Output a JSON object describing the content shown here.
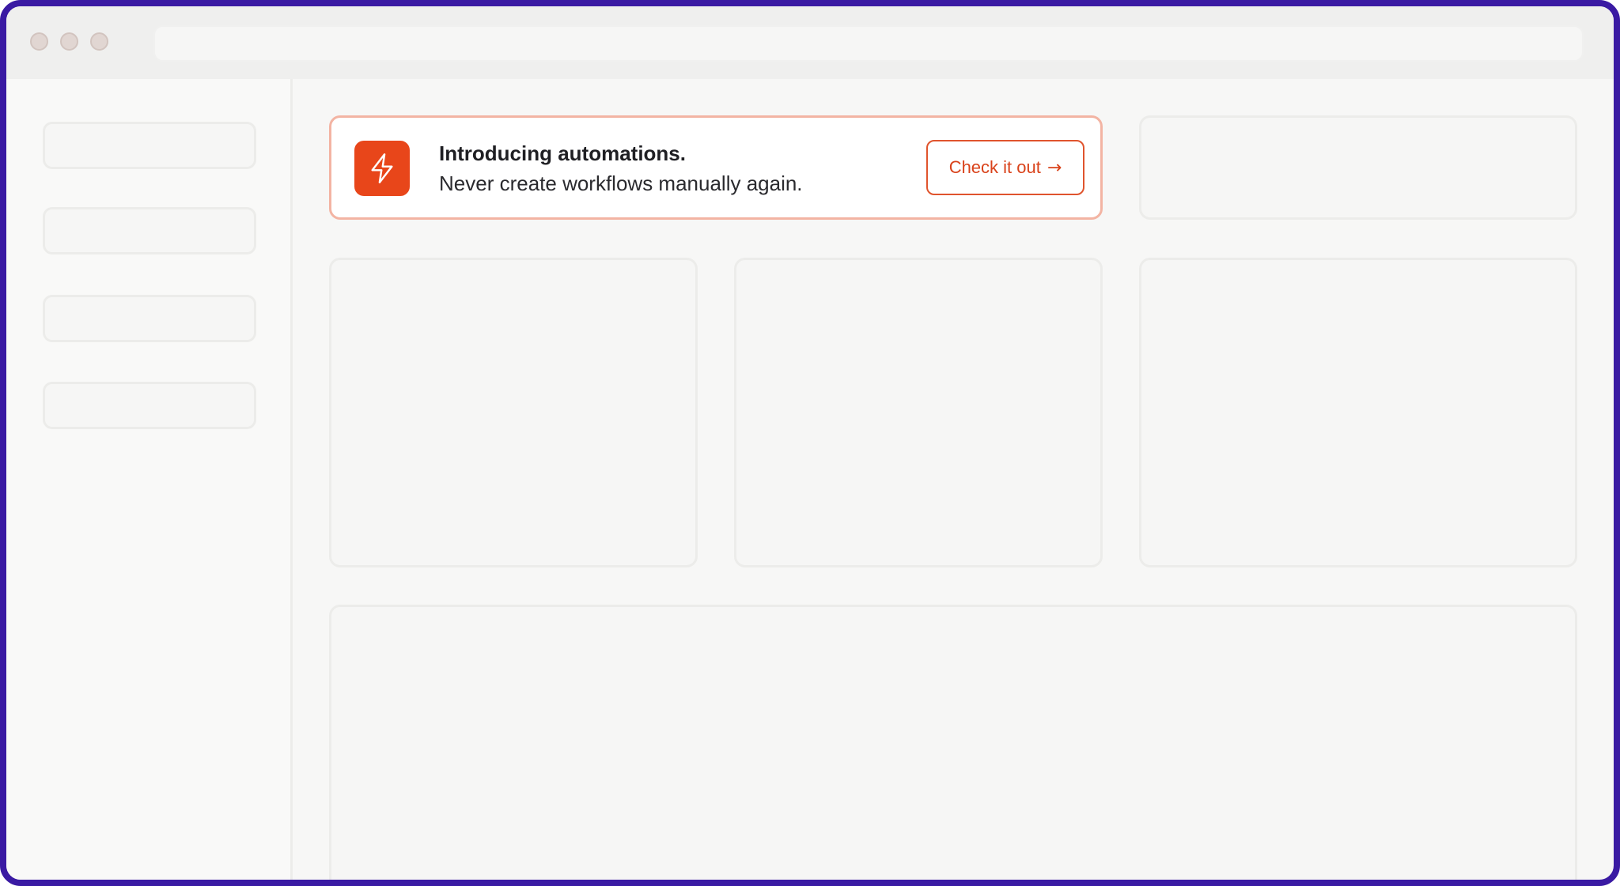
{
  "colors": {
    "frame_border": "#3a1aa3",
    "accent": "#e8461a",
    "accent_text": "#d9421a",
    "banner_border": "#f3b4a3"
  },
  "banner": {
    "icon": "lightning-bolt-icon",
    "title": "Introducing automations.",
    "subtitle": "Never create workflows manually again.",
    "cta_label": "Check it out",
    "cta_arrow": "→"
  }
}
